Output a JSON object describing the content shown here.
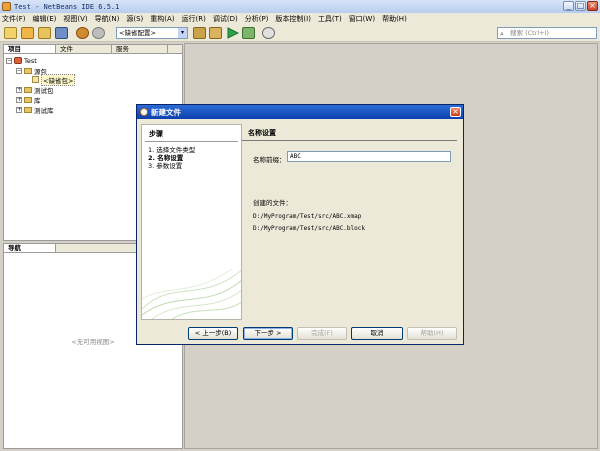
{
  "window": {
    "title": "Test - NetBeans IDE 6.5.1",
    "controls": {
      "minimize": "_",
      "maximize": "□",
      "close": "×"
    }
  },
  "menubar": {
    "items": [
      "文件(F)",
      "编辑(E)",
      "视图(V)",
      "导航(N)",
      "源(S)",
      "重构(A)",
      "运行(R)",
      "调试(D)",
      "分析(P)",
      "版本控制(I)",
      "工具(T)",
      "窗口(W)",
      "帮助(H)"
    ]
  },
  "toolbar": {
    "config_value": "<缺省配置>",
    "config_dropdown": "▾",
    "search_placeholder": "搜索 (Ctrl+I)",
    "icons": [
      "new-file-icon",
      "new-project-icon",
      "open-project-icon",
      "save-all-icon",
      "undo-icon",
      "redo-icon",
      "build-icon",
      "clean-build-icon",
      "run-icon",
      "debug-icon",
      "profile-icon"
    ]
  },
  "projects_panel": {
    "tabs": [
      "项目",
      "文件",
      "服务"
    ],
    "tree": {
      "project": "Test",
      "source_packages": "源包",
      "default_package": "<缺省包>",
      "test_packages": "测试包",
      "libraries": "库",
      "test_libraries": "测试库"
    }
  },
  "navigator_panel": {
    "title": "导航",
    "empty_text": "<无可用视图>"
  },
  "dialog": {
    "title": "新建文件",
    "steps_heading": "步骤",
    "steps": [
      "1.  选择文件类型",
      "2.  名称设置",
      "3.  参数设置"
    ],
    "current_step": 1,
    "section_heading": "名称设置",
    "name_label": "名称前缀：",
    "name_value": "ABC",
    "created_files_label": "创建的文件：",
    "created_files": [
      "D:/MyProgram/Test/src/ABC.xmap",
      "D:/MyProgram/Test/src/ABC.block"
    ],
    "buttons": {
      "back": "< 上一步(B)",
      "next": "下一步 >",
      "finish": "完成(F)",
      "cancel": "取消",
      "help": "帮助(H)"
    }
  },
  "colors": {
    "dialog_title": "#0a3fae",
    "window_title": "#b8cdee",
    "run_green": "#2ea44a"
  }
}
